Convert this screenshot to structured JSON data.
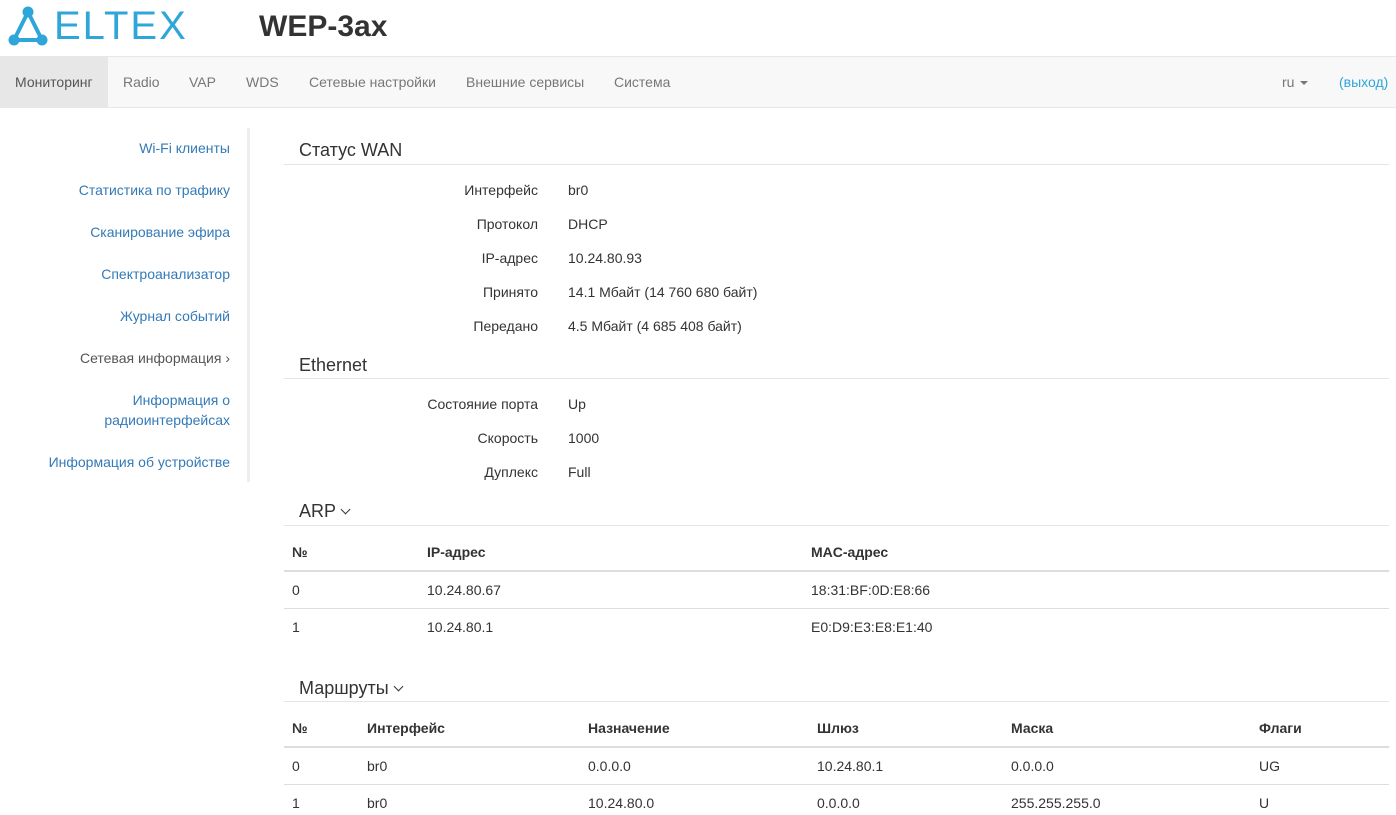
{
  "header": {
    "brand": "ELTEX",
    "device": "WEP-3ax"
  },
  "nav": {
    "items": [
      "Мониторинг",
      "Radio",
      "VAP",
      "WDS",
      "Сетевые настройки",
      "Внешние сервисы",
      "Система"
    ],
    "lang": "ru",
    "logout": "(выход)"
  },
  "sidebar": {
    "items": [
      "Wi-Fi клиенты",
      "Статистика по трафику",
      "Сканирование эфира",
      "Спектроанализатор",
      "Журнал событий",
      "Сетевая информация ›",
      "Информация о",
      "радиоинтерфейсах",
      "Информация об устройстве"
    ]
  },
  "wan": {
    "title": "Статус WAN",
    "rows": [
      {
        "label": "Интерфейс",
        "value": "br0"
      },
      {
        "label": "Протокол",
        "value": "DHCP"
      },
      {
        "label": "IP-адрес",
        "value": "10.24.80.93"
      },
      {
        "label": "Принято",
        "value": "14.1 Мбайт (14 760 680 байт)"
      },
      {
        "label": "Передано",
        "value": "4.5 Мбайт (4 685 408 байт)"
      }
    ]
  },
  "ethernet": {
    "title": "Ethernet",
    "rows": [
      {
        "label": "Состояние порта",
        "value": "Up"
      },
      {
        "label": "Скорость",
        "value": "1000"
      },
      {
        "label": "Дуплекс",
        "value": "Full"
      }
    ]
  },
  "arp": {
    "title": "ARP",
    "headers": [
      "№",
      "IP-адрес",
      "MAC-адрес"
    ],
    "rows": [
      [
        "0",
        "10.24.80.67",
        "18:31:BF:0D:E8:66"
      ],
      [
        "1",
        "10.24.80.1",
        "E0:D9:E3:E8:E1:40"
      ]
    ]
  },
  "routes": {
    "title": "Маршруты",
    "headers": [
      "№",
      "Интерфейс",
      "Назначение",
      "Шлюз",
      "Маска",
      "Флаги"
    ],
    "rows": [
      [
        "0",
        "br0",
        "0.0.0.0",
        "10.24.80.1",
        "0.0.0.0",
        "UG"
      ],
      [
        "1",
        "br0",
        "10.24.80.0",
        "0.0.0.0",
        "255.255.255.0",
        "U"
      ]
    ]
  },
  "colors": {
    "brand": "#2ea6d9",
    "link": "#337ab7",
    "navbar_bg": "#f8f8f8",
    "nav_active_bg": "#e7e7e7"
  }
}
